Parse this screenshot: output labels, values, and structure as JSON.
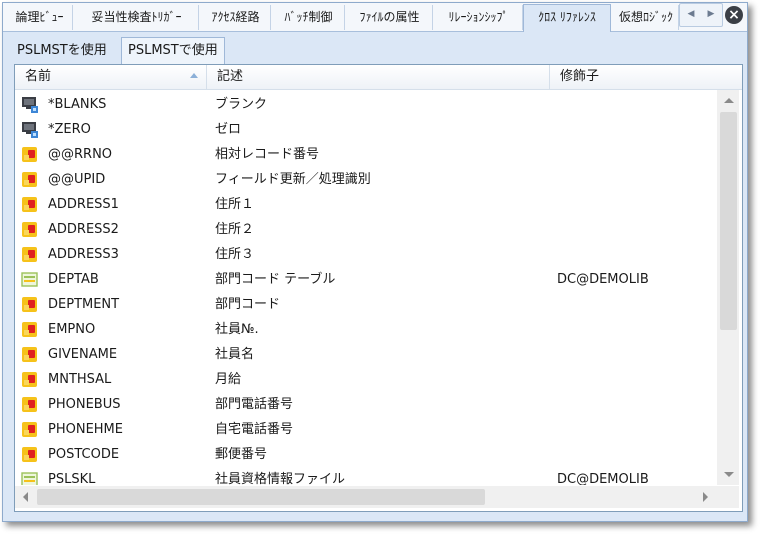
{
  "tabs": [
    {
      "label": "論理ﾋﾞｭｰ"
    },
    {
      "label": "妥当性検査ﾄﾘｶﾞｰ"
    },
    {
      "label": "ｱｸｾｽ経路"
    },
    {
      "label": "ﾊﾞｯﾁ制御"
    },
    {
      "label": "ﾌｧｲﾙの属性"
    },
    {
      "label": "ﾘﾚｰｼｮﾝｼｯﾌﾟ"
    },
    {
      "label": "ｸﾛｽ ﾘﾌｧﾚﾝｽ"
    },
    {
      "label": "仮想ﾛｼﾞｯｸ"
    }
  ],
  "subtabs": [
    {
      "label": "PSLMSTを使用"
    },
    {
      "label": "PSLMSTで使用"
    }
  ],
  "columns": {
    "name": "名前",
    "description": "記述",
    "modifier": "修飾子"
  },
  "rows": [
    {
      "icon": "system-field-icon",
      "name": "*BLANKS",
      "desc": "ブランク",
      "mod": ""
    },
    {
      "icon": "system-field-icon",
      "name": "*ZERO",
      "desc": "ゼロ",
      "mod": ""
    },
    {
      "icon": "field-icon",
      "name": "@@RRNO",
      "desc": "相対レコード番号",
      "mod": ""
    },
    {
      "icon": "field-icon",
      "name": "@@UPID",
      "desc": "フィールド更新／処理識別",
      "mod": ""
    },
    {
      "icon": "field-icon",
      "name": "ADDRESS1",
      "desc": "住所１",
      "mod": ""
    },
    {
      "icon": "field-icon",
      "name": "ADDRESS2",
      "desc": "住所２",
      "mod": ""
    },
    {
      "icon": "field-icon",
      "name": "ADDRESS3",
      "desc": "住所３",
      "mod": ""
    },
    {
      "icon": "file-icon",
      "name": "DEPTAB",
      "desc": "部門コード テーブル",
      "mod": "DC@DEMOLIB"
    },
    {
      "icon": "field-icon",
      "name": "DEPTMENT",
      "desc": "部門コード",
      "mod": ""
    },
    {
      "icon": "field-icon",
      "name": "EMPNO",
      "desc": "社員№.",
      "mod": ""
    },
    {
      "icon": "field-icon",
      "name": "GIVENAME",
      "desc": "社員名",
      "mod": ""
    },
    {
      "icon": "field-icon",
      "name": "MNTHSAL",
      "desc": "月給",
      "mod": ""
    },
    {
      "icon": "field-icon",
      "name": "PHONEBUS",
      "desc": "部門電話番号",
      "mod": ""
    },
    {
      "icon": "field-icon",
      "name": "PHONEHME",
      "desc": "自宅電話番号",
      "mod": ""
    },
    {
      "icon": "field-icon",
      "name": "POSTCODE",
      "desc": "郵便番号",
      "mod": ""
    },
    {
      "icon": "file-icon",
      "name": "PSLSKL",
      "desc": "社員資格情報ファイル",
      "mod": "DC@DEMOLIB"
    }
  ],
  "colors": {
    "field_icon_yellow": "#f6c21a",
    "field_icon_red": "#e02020",
    "file_icon_green": "#9cc25a",
    "system_icon_dark": "#3a3d44",
    "system_icon_blue": "#3d86d6"
  }
}
